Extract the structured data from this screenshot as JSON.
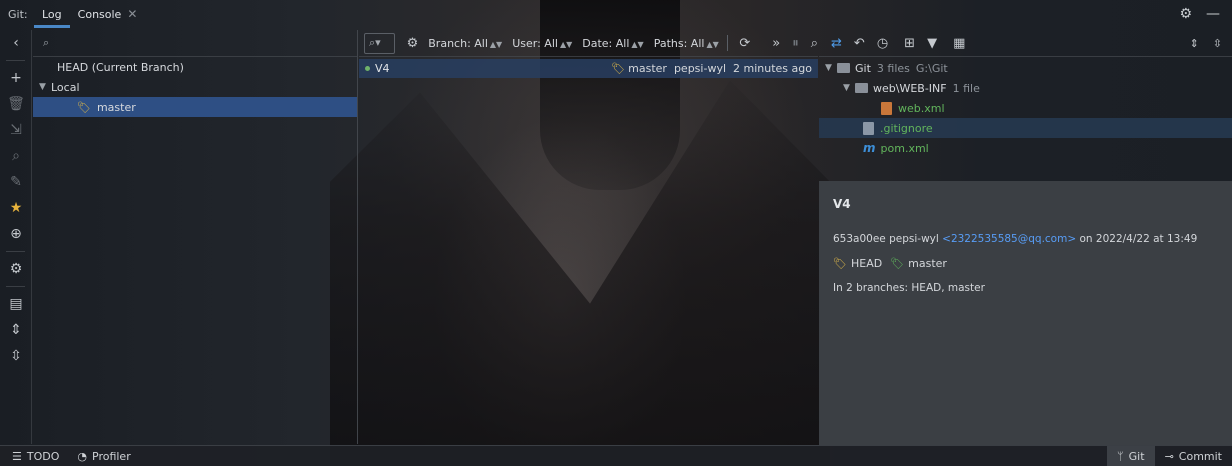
{
  "toolwindow": {
    "label": "Git:",
    "tabs": [
      {
        "label": "Log",
        "active": true
      },
      {
        "label": "Console",
        "active": false,
        "closable": true
      }
    ]
  },
  "branches": {
    "head": "HEAD (Current Branch)",
    "local_label": "Local",
    "selected_branch": "master"
  },
  "log_toolbar": {
    "branch_filter": "Branch: All",
    "user_filter": "User: All",
    "date_filter": "Date: All",
    "paths_filter": "Paths: All",
    "more": "»"
  },
  "commit": {
    "message": "V4",
    "tag": "master",
    "author": "pepsi-wyl",
    "time": "2 minutes ago"
  },
  "changes": {
    "root_name": "Git",
    "root_count": "3 files",
    "root_path": "G:\\Git",
    "folder_name": "web\\WEB-INF",
    "folder_count": "1 file",
    "files": [
      "web.xml",
      ".gitignore",
      "pom.xml"
    ]
  },
  "details": {
    "title": "V4",
    "hash": "653a00ee",
    "author": "pepsi-wyl",
    "email": "<2322535585@qq.com>",
    "on": "on",
    "date": "2022/4/22 at 13:49",
    "tag_head": "HEAD",
    "tag_master": "master",
    "branches_line": "In 2 branches: HEAD, master"
  },
  "statusbar": {
    "todo": "TODO",
    "profiler": "Profiler",
    "git": "Git",
    "commit": "Commit"
  },
  "colors": {
    "selection": "#2e4f84",
    "accent": "#4a88c7",
    "tag": "#d9b44a",
    "link": "#589df6",
    "added": "#62b55c"
  }
}
